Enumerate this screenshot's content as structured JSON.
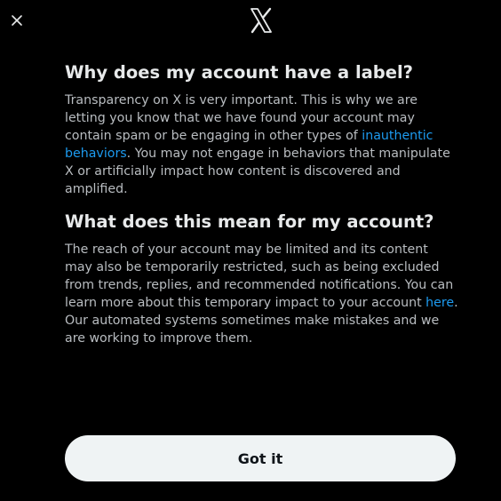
{
  "header": {
    "close_icon": "close-icon",
    "logo_icon": "x-logo-icon"
  },
  "section1": {
    "heading": "Why does my account have a label?",
    "text_before_link": "Transparency on X is very important. This is why we are letting you know that we have found your account may contain spam or be engaging in other types of ",
    "link_text": "inauthentic behaviors",
    "text_after_link": ". You may not engage in behaviors that manipulate X or artificially impact how content is discovered and amplified."
  },
  "section2": {
    "heading": "What does this mean for my account?",
    "text_before_link": "The reach of your account may be limited and its content may also be temporarily restricted, such as being excluded from trends, replies, and recommended notifications. You can learn more about this temporary impact to your account ",
    "link_text": "here",
    "text_after_link": ". Our automated systems sometimes make mistakes and we are working to improve them."
  },
  "footer": {
    "button_label": "Got it"
  },
  "colors": {
    "background": "#000000",
    "link": "#1d9bf0",
    "button_bg": "#eff3f4"
  }
}
